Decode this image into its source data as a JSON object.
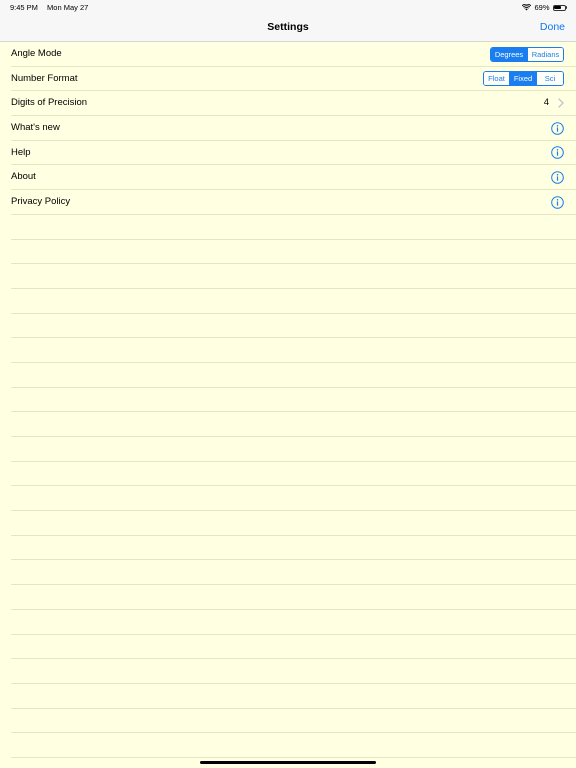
{
  "status_bar": {
    "time": "9:45 PM",
    "date": "Mon May 27",
    "battery": "69%",
    "battery_level": 0.69
  },
  "nav": {
    "title": "Settings",
    "done_label": "Done"
  },
  "rows": {
    "angle_mode": {
      "label": "Angle Mode",
      "options": [
        "Degrees",
        "Radians"
      ],
      "selected": "Degrees"
    },
    "number_format": {
      "label": "Number Format",
      "options": [
        "Float",
        "Fixed",
        "Sci"
      ],
      "selected": "Fixed"
    },
    "precision": {
      "label": "Digits of Precision",
      "value": "4"
    },
    "whats_new": {
      "label": "What's new"
    },
    "help": {
      "label": "Help"
    },
    "about": {
      "label": "About"
    },
    "privacy": {
      "label": "Privacy Policy"
    }
  },
  "colors": {
    "background": "#ffffe2",
    "accent": "#1a7ef0",
    "separator": "#e6e6c7"
  },
  "icons": {
    "chevron": "chevron-right-icon",
    "info": "info-circle-icon",
    "wifi": "wifi-icon",
    "battery": "battery-icon"
  }
}
